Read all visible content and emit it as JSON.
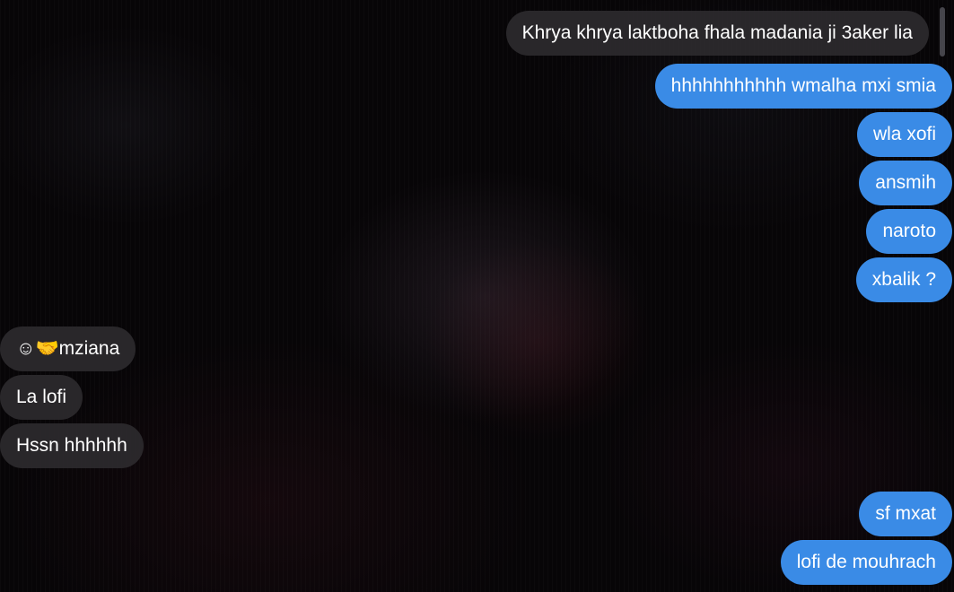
{
  "messages": [
    {
      "id": "m1",
      "direction": "outgoing-grey",
      "text": "Khrya khrya laktboha fhala madania ji 3aker lia"
    },
    {
      "id": "m2",
      "direction": "outgoing",
      "text": "hhhhhhhhhhh wmalha mxi smia"
    },
    {
      "id": "m3",
      "direction": "outgoing",
      "text": "wla xofi"
    },
    {
      "id": "m4",
      "direction": "outgoing",
      "text": "ansmih"
    },
    {
      "id": "m5",
      "direction": "outgoing",
      "text": "naroto"
    },
    {
      "id": "m6",
      "direction": "outgoing",
      "text": "xbalik ?"
    },
    {
      "id": "m7",
      "direction": "incoming",
      "text": "☺🤝mziana"
    },
    {
      "id": "m8",
      "direction": "incoming",
      "text": "La lofi"
    },
    {
      "id": "m9",
      "direction": "incoming",
      "text": "Hssn hhhhhh"
    },
    {
      "id": "m10",
      "direction": "outgoing",
      "text": "sf mxat"
    },
    {
      "id": "m11",
      "direction": "outgoing",
      "text": "lofi de mouhrach"
    }
  ],
  "colors": {
    "outgoing_bubble": "#3a8be6",
    "incoming_bubble": "#2c2a2e",
    "text": "#ffffff",
    "background": "#070507"
  }
}
